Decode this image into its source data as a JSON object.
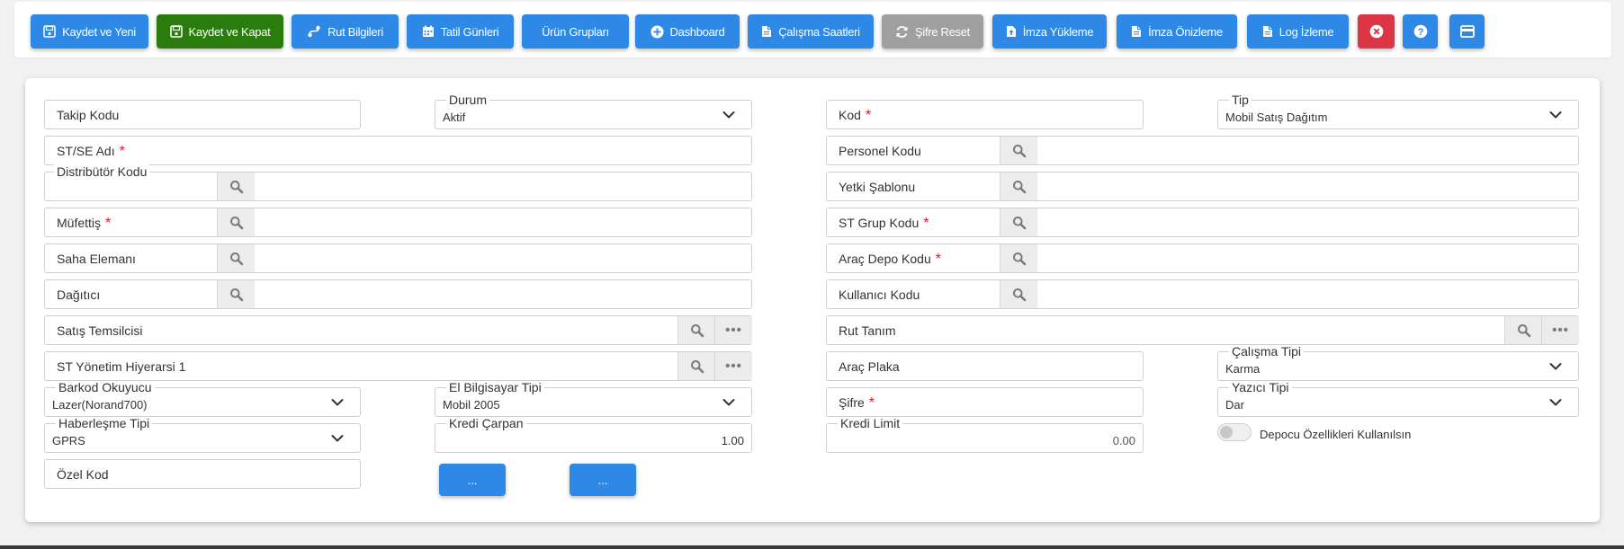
{
  "toolbar": {
    "save_new": "Kaydet ve Yeni",
    "save_close": "Kaydet ve Kapat",
    "route_info": "Rut Bilgileri",
    "holidays": "Tatil Günleri",
    "product_groups": "Ürün Grupları",
    "dashboard": "Dashboard",
    "working_hours": "Çalışma Saatleri",
    "password_reset": "Şifre Reset",
    "signature_upload": "İmza Yükleme",
    "signature_preview": "İmza Önizleme",
    "log_view": "Log İzleme"
  },
  "icons": {
    "save": "floppy-disk-icon",
    "route": "route-icon",
    "calendar": "calendar-icon",
    "plus": "plus-circle-icon",
    "document": "file-icon",
    "refresh": "refresh-icon",
    "upload": "file-upload-icon",
    "close": "close-circle-icon",
    "help": "question-circle-icon",
    "window": "window-icon",
    "search": "search-icon",
    "more": "more-dots-icon",
    "chevron": "chevron-down-icon"
  },
  "colors": {
    "primary": "#2d89e5",
    "success": "#2a7c0d",
    "secondary": "#9f9f9f",
    "danger": "#dc3545",
    "required": "#e0162b"
  },
  "form": {
    "left": {
      "takip_kodu": "Takip Kodu",
      "durum_label": "Durum",
      "durum_value": "Aktif",
      "st_se_adi": "ST/SE Adı",
      "distributor_kodu": "Distribütör Kodu",
      "mufettis": "Müfettiş",
      "saha_elemani": "Saha Elemanı",
      "dagitici": "Dağıtıcı",
      "satis_temsilcisi": "Satış Temsilcisi",
      "st_yonetim_hiyerarsi": "ST Yönetim Hiyerarsi 1",
      "barkod_okuyucu_label": "Barkod Okuyucu",
      "barkod_okuyucu_value": "Lazer(Norand700)",
      "el_bilgisayar_label": "El Bilgisayar Tipi",
      "el_bilgisayar_value": "Mobil 2005",
      "haberlesme_label": "Haberleşme Tipi",
      "haberlesme_value": "GPRS",
      "kredi_carpan_label": "Kredi Çarpan",
      "kredi_carpan_value": "1.00",
      "ozel_kod": "Özel Kod",
      "extra_button_1": "...",
      "extra_button_2": "..."
    },
    "right": {
      "kod": "Kod",
      "tip_label": "Tip",
      "tip_value": "Mobil Satış Dağıtım",
      "personel_kodu": "Personel Kodu",
      "yetki_sablonu": "Yetki Şablonu",
      "st_grup_kodu": "ST Grup Kodu",
      "arac_depo_kodu": "Araç Depo Kodu",
      "kullanici_kodu": "Kullanıcı Kodu",
      "rut_tanim": "Rut Tanım",
      "arac_plaka": "Araç Plaka",
      "calisma_tipi_label": "Çalışma Tipi",
      "calisma_tipi_value": "Karma",
      "sifre": "Şifre",
      "yazici_tipi_label": "Yazıcı Tipi",
      "yazici_tipi_value": "Dar",
      "kredi_limit_label": "Kredi Limit",
      "kredi_limit_value": "0.00",
      "depocu_toggle_label": "Depocu Özellikleri Kullanılsın"
    },
    "required_mark": "*",
    "more_glyph": "•••"
  }
}
